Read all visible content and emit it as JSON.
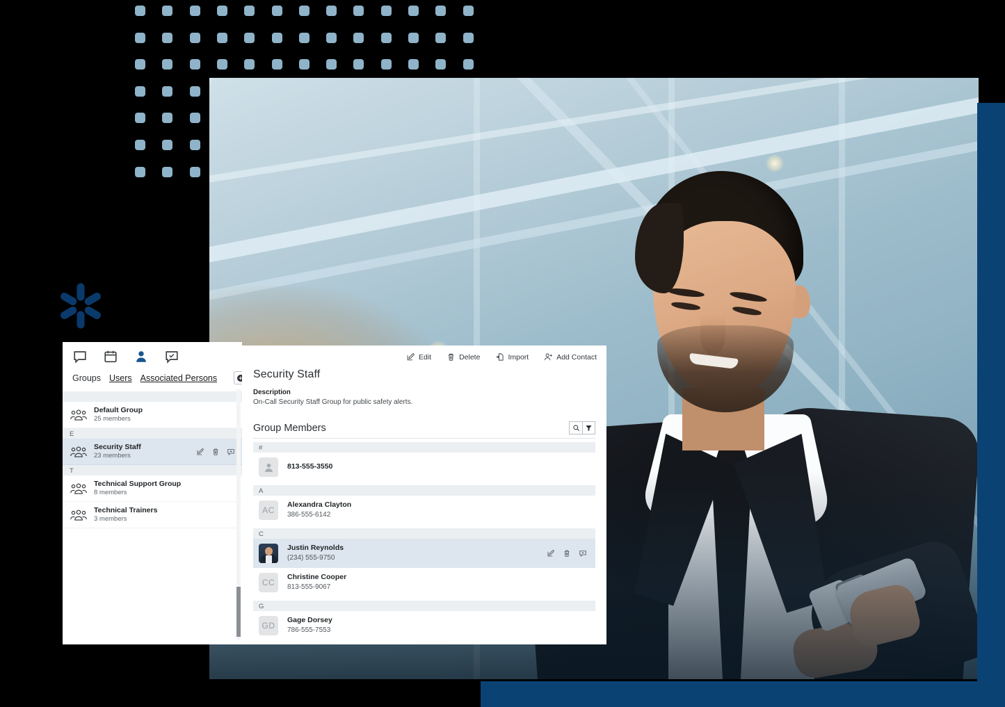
{
  "theme": {
    "background": "#000000",
    "accent_blue": "#0b4274",
    "dot_color": "#8fb3c9",
    "logo_color": "#0a3a6b",
    "selection": "#dde5ee",
    "section_header_bg": "#eceff1"
  },
  "decor": {
    "logo_name": "spark-starburst-logo",
    "dot_pattern_name": "dot-grid-pattern"
  },
  "hero": {
    "alt": "Businessman in dark suit and tie smiling at his mobile phone inside a modern glass office building"
  },
  "sidebar": {
    "icon_tabs": [
      {
        "name": "chat-icon",
        "label": "Messages",
        "active": false
      },
      {
        "name": "calendar-icon",
        "label": "Calendar",
        "active": false
      },
      {
        "name": "person-icon",
        "label": "Contacts",
        "active": true
      },
      {
        "name": "chat-check-icon",
        "label": "Confirmations",
        "active": false
      }
    ],
    "tabs": [
      {
        "label": "Groups",
        "active": true
      },
      {
        "label": "Users",
        "active": false
      },
      {
        "label": "Associated Persons",
        "active": false
      }
    ],
    "add_button": "add-circle-icon",
    "search_button": "search-icon",
    "sections": [
      {
        "letter": "",
        "groups": [
          {
            "name": "Default Group",
            "members": "25 members",
            "selected": false
          }
        ]
      },
      {
        "letter": "E",
        "groups": [
          {
            "name": "Security Staff",
            "members": "23 members",
            "selected": true
          }
        ]
      },
      {
        "letter": "T",
        "groups": [
          {
            "name": "Technical Support Group",
            "members": "8 members",
            "selected": false
          },
          {
            "name": "Technical Trainers",
            "members": "3 members",
            "selected": false
          }
        ]
      }
    ],
    "row_actions": [
      {
        "name": "edit-icon",
        "label": "Edit"
      },
      {
        "name": "delete-icon",
        "label": "Delete"
      },
      {
        "name": "message-plus-icon",
        "label": "Send message"
      }
    ]
  },
  "main": {
    "toolbar": [
      {
        "label": "Edit",
        "icon": "edit-icon"
      },
      {
        "label": "Delete",
        "icon": "delete-icon"
      },
      {
        "label": "Import",
        "icon": "import-icon"
      },
      {
        "label": "Add Contact",
        "icon": "add-contact-icon"
      }
    ],
    "title": "Security Staff",
    "description_label": "Description",
    "description_text": "On-Call Security Staff Group for public safety alerts.",
    "members_title": "Group Members",
    "members_search_icon": "search-icon",
    "members_filter_icon": "filter-icon",
    "member_sections": [
      {
        "letter": "#",
        "members": [
          {
            "name": "813-555-3550",
            "phone": "",
            "avatar_type": "placeholder",
            "initials": "",
            "selected": false
          }
        ]
      },
      {
        "letter": "A",
        "members": [
          {
            "name": "Alexandra Clayton",
            "phone": "386-555-6142",
            "avatar_type": "initials",
            "initials": "AC",
            "selected": false
          }
        ]
      },
      {
        "letter": "C",
        "members": [
          {
            "name": "Justin Reynolds",
            "phone": "(234) 555-9750",
            "avatar_type": "photo",
            "initials": "",
            "selected": true
          },
          {
            "name": "Christine Cooper",
            "phone": "813-555-9067",
            "avatar_type": "initials",
            "initials": "CC",
            "selected": false
          }
        ]
      },
      {
        "letter": "G",
        "members": [
          {
            "name": "Gage Dorsey",
            "phone": "786-555-7553",
            "avatar_type": "initials",
            "initials": "GD",
            "selected": false
          }
        ]
      }
    ],
    "row_actions": [
      {
        "name": "edit-icon",
        "label": "Edit"
      },
      {
        "name": "delete-icon",
        "label": "Delete"
      },
      {
        "name": "message-plus-icon",
        "label": "Send message"
      }
    ]
  }
}
